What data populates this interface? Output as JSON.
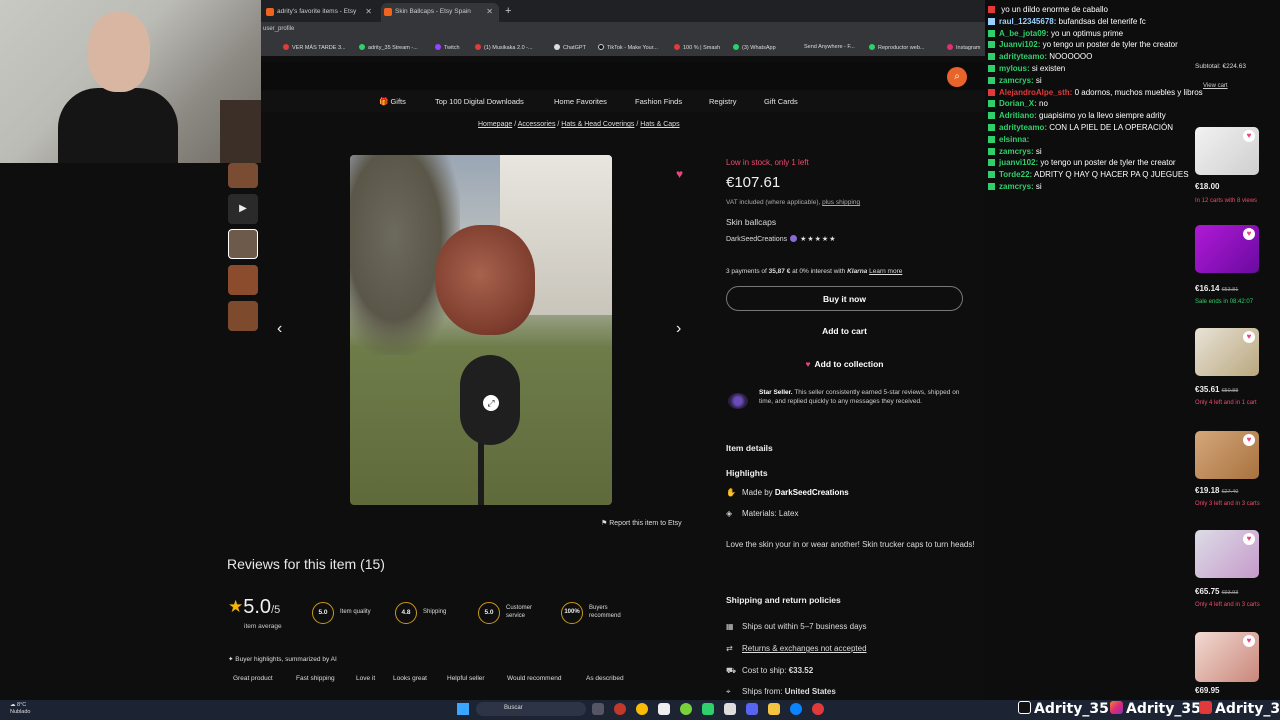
{
  "browser": {
    "tabs": [
      {
        "label": "adrity's favorite items - Etsy"
      },
      {
        "label": "Skin Ballcaps - Etsy Spain"
      }
    ],
    "url_fragment": "user_profile",
    "bookmarks": [
      "VER MÁS TARDE 3...",
      "adrity_35 Stream -...",
      "Twitch",
      "(1) Musikaka 2.0 -...",
      "ChatGPT",
      "TikTok - Make Your...",
      "100 % | Smash",
      "(3) WhatsApp",
      "Send Anywhere - F...",
      "Reproductor web...",
      "Instagram"
    ]
  },
  "nav": [
    "Gifts",
    "Top 100 Digital Downloads",
    "Home Favorites",
    "Fashion Finds",
    "Registry",
    "Gift Cards"
  ],
  "breadcrumb": [
    "Homepage",
    "Accessories",
    "Hats & Head Coverings",
    "Hats & Caps"
  ],
  "product": {
    "low_stock": "Low in stock, only 1 left",
    "price": "€107.61",
    "vat_text": "VAT included (where applicable),",
    "vat_link": "plus shipping",
    "title": "Skin ballcaps",
    "seller": "DarkSeedCreations",
    "rating_stars": "★★★★★",
    "klarna_prefix": "3 payments of",
    "klarna_amount": "35,87 €",
    "klarna_mid": "at 0% interest with",
    "klarna_brand": "Klarna",
    "klarna_link": "Learn more",
    "buy_now": "Buy it now",
    "add_cart": "Add to cart",
    "add_collection": "Add to collection",
    "star_seller_bold": "Star Seller.",
    "star_seller_text": "This seller consistently earned 5-star reviews, shipped on time, and replied quickly to any messages they received.",
    "report": "Report this item to Etsy"
  },
  "details": {
    "section_title": "Item details",
    "highlights_title": "Highlights",
    "made_by_label": "Made by",
    "made_by_value": "DarkSeedCreations",
    "materials": "Materials: Latex",
    "description": "Love the skin your in or wear another! Skin trucker caps to turn heads!"
  },
  "shipping": {
    "title": "Shipping and return policies",
    "ships_out": "Ships out within 5–7 business days",
    "returns": "Returns & exchanges not accepted",
    "cost_label": "Cost to ship:",
    "cost_value": "€33.52",
    "ships_from_label": "Ships from:",
    "ships_from_value": "United States"
  },
  "reviews": {
    "title": "Reviews for this item (15)",
    "average": "5.0",
    "out_of": "/5",
    "average_label": "item average",
    "scores": [
      {
        "value": "5.0",
        "label": "Item quality"
      },
      {
        "value": "4.8",
        "label": "Shipping"
      },
      {
        "value": "5.0",
        "label": "Customer\nservice"
      },
      {
        "value": "100%",
        "label": "Buyers\nrecommend"
      }
    ],
    "ai_heading": "Buyer highlights, summarized by AI",
    "chips": [
      "Great product",
      "Fast shipping",
      "Love it",
      "Looks great",
      "Helpful seller",
      "Would recommend",
      "As described"
    ]
  },
  "cart": {
    "subtotal": "Subtotal: €224.63",
    "view_cart": "View cart",
    "items": [
      {
        "price": "€18.00",
        "old": "",
        "note": "In 12 carts with 8 views",
        "note_color": "red"
      },
      {
        "price": "€16.14",
        "old": "€53.81",
        "note": "Sale ends in 08:42:07",
        "note_color": "green"
      },
      {
        "price": "€35.61",
        "old": "€50.88",
        "note": "Only 4 left and in 1 cart",
        "note_color": "red"
      },
      {
        "price": "€19.18",
        "old": "€27.40",
        "note": "Only 3 left and in 3 carts",
        "note_color": "red"
      },
      {
        "price": "€65.75",
        "old": "€93.93",
        "note": "Only 4 left and in 3 carts",
        "note_color": "red"
      },
      {
        "price": "€69.95",
        "old": "",
        "note": "",
        "note_color": "red"
      }
    ]
  },
  "chat": [
    {
      "user": "",
      "msg": "yo un dildo enorme de caballo",
      "color": "#e03a3a"
    },
    {
      "user": "raul_12345678:",
      "msg": "bufandsas del tenerife fc",
      "color": "#9ad0ff"
    },
    {
      "user": "A_be_jota09:",
      "msg": "yo un optimus prime",
      "color": "#2fd06c"
    },
    {
      "user": "Juanvi102:",
      "msg": "yo tengo un poster de tyler the creator",
      "color": "#2fd06c"
    },
    {
      "user": "adrityteamo:",
      "msg": "NOOOOOO",
      "color": "#2fd06c"
    },
    {
      "user": "mylous:",
      "msg": "si existen",
      "color": "#2fd06c"
    },
    {
      "user": "zamcrys:",
      "msg": "si",
      "color": "#2fd06c"
    },
    {
      "user": "AlejandroAlpe_sth:",
      "msg": "0 adornos, muchos muebles y libros",
      "color": "#e03a3a"
    },
    {
      "user": "Dorian_X:",
      "msg": "no",
      "color": "#2fd06c"
    },
    {
      "user": "Adritiano:",
      "msg": "guapisimo yo la llevo siempre adrity",
      "color": "#2fd06c"
    },
    {
      "user": "adrityteamo:",
      "msg": "CON LA PIEL DE LA OPERACIÓN",
      "color": "#2fd06c"
    },
    {
      "user": "elsinna:",
      "msg": "",
      "color": "#2fd06c"
    },
    {
      "user": "zamcrys:",
      "msg": "si",
      "color": "#2fd06c"
    },
    {
      "user": "juanvi102:",
      "msg": "yo tengo un poster de tyler the creator",
      "color": "#2fd06c"
    },
    {
      "user": "Torde22:",
      "msg": "ADRITY Q HAY Q HACER PA Q JUEGUES",
      "color": "#2fd06c"
    },
    {
      "user": "zamcrys:",
      "msg": "si",
      "color": "#2fd06c"
    }
  ],
  "taskbar": {
    "weather_temp": "8°C",
    "weather_desc": "Nublado",
    "search": "Buscar"
  },
  "socials": [
    "Adrity_35",
    "Adrity_35",
    "Adrity_35"
  ],
  "colors": {
    "accent": "#e8642a",
    "heart": "#e9457d",
    "low_stock": "#f04a6f",
    "star": "#f2b30a"
  }
}
